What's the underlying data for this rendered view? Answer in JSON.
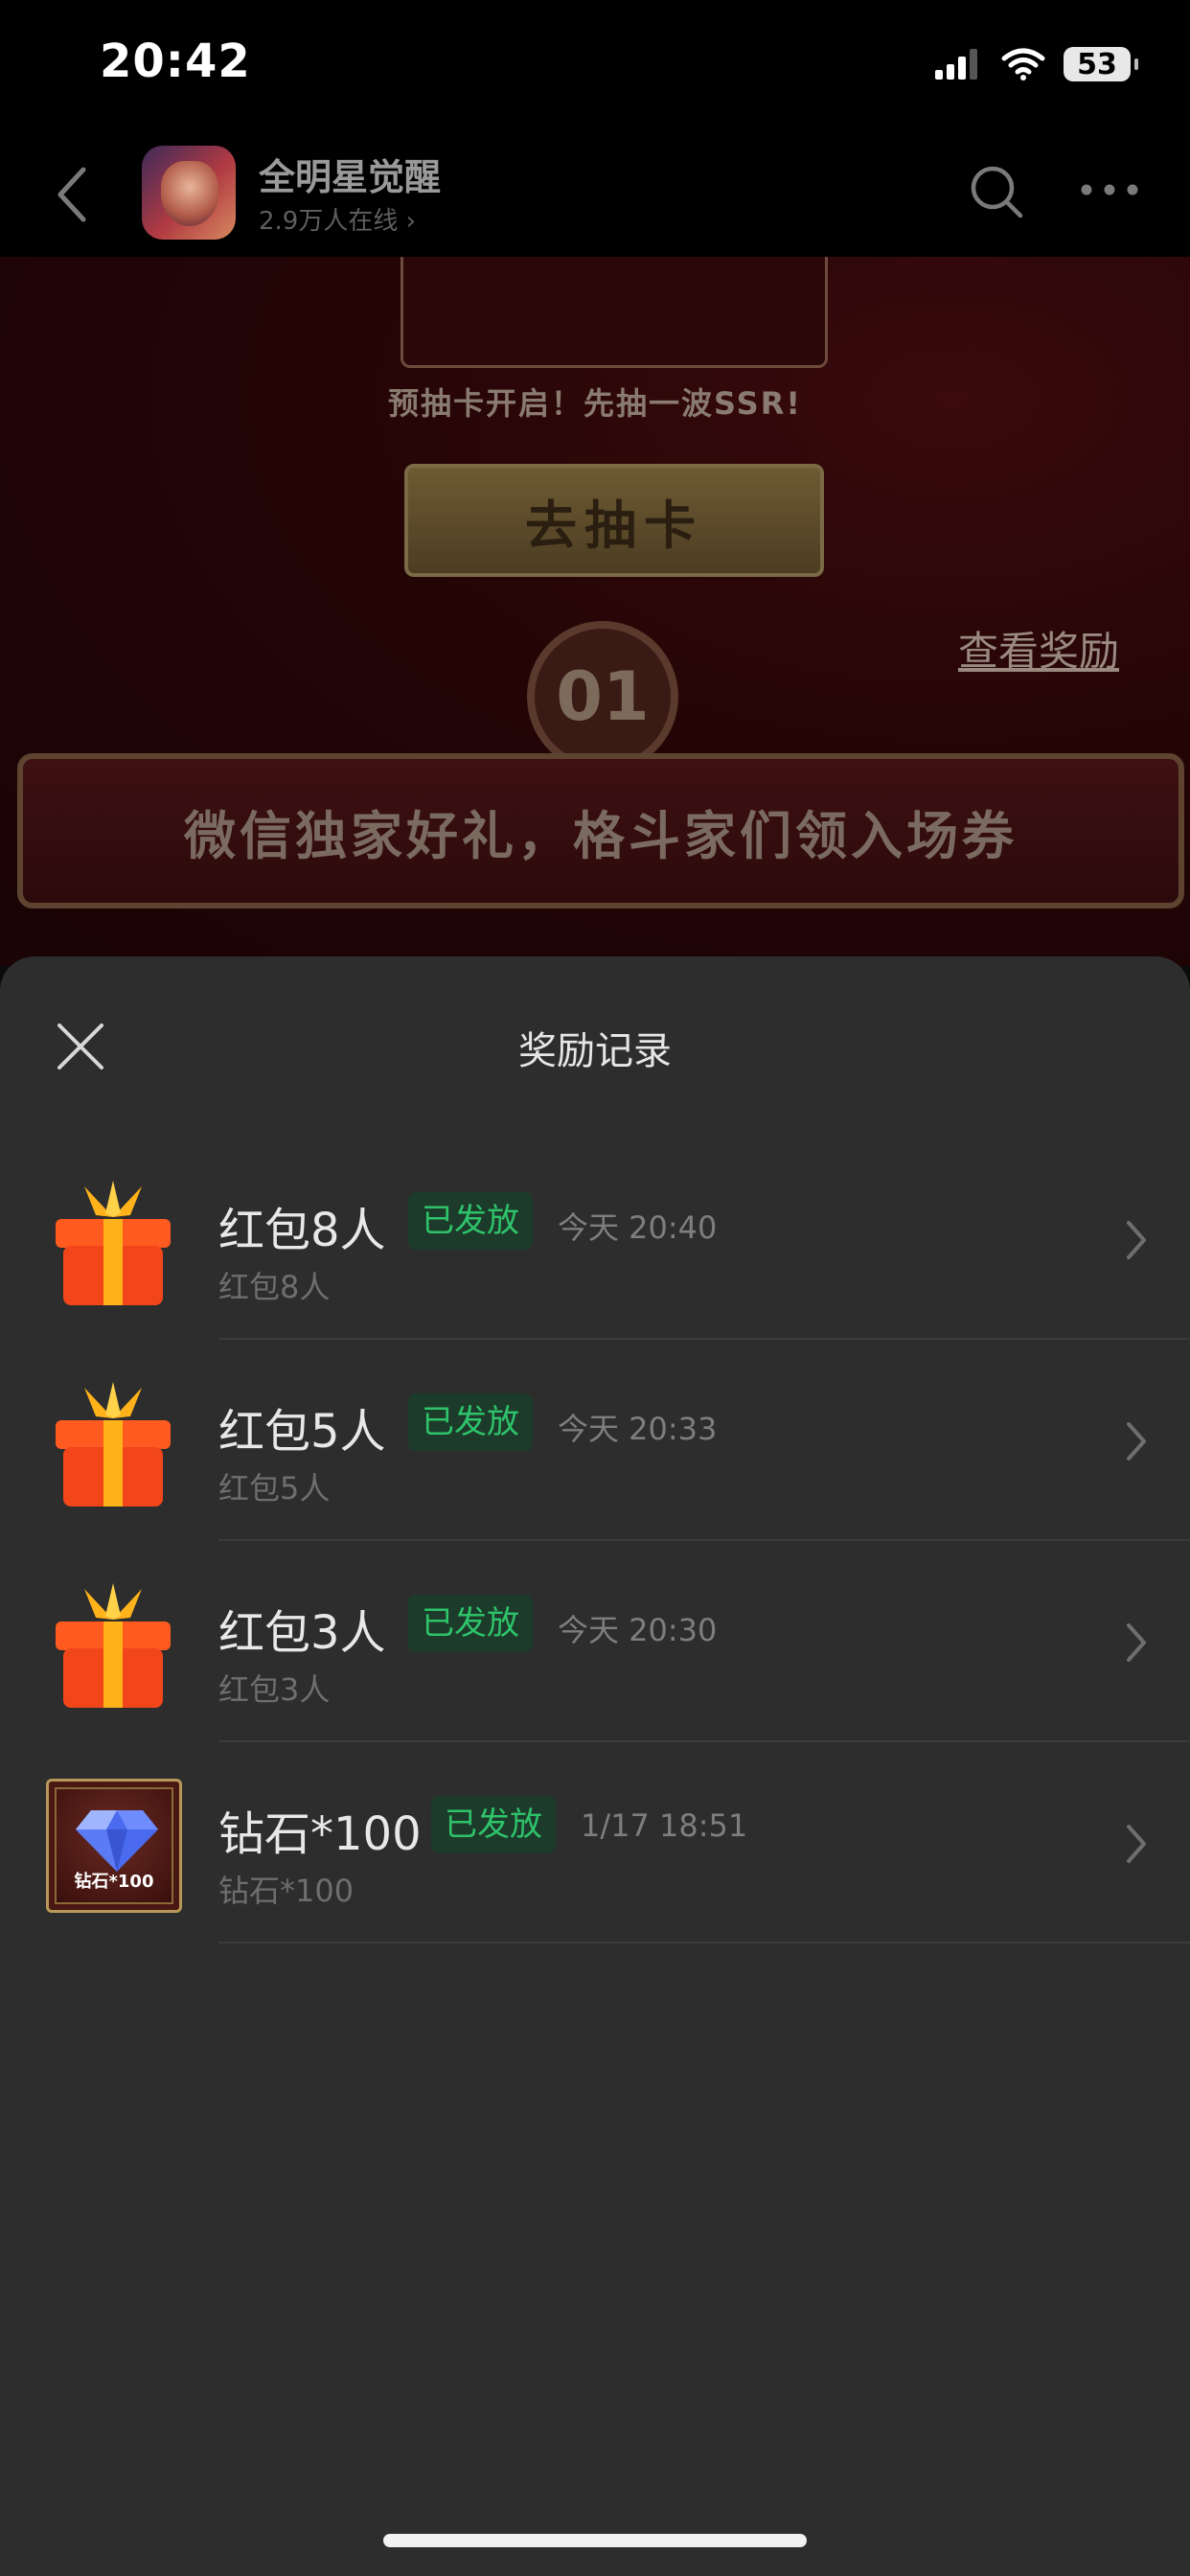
{
  "status_bar": {
    "time": "20:42",
    "battery": "53"
  },
  "nav": {
    "app_name": "全明星觉醒",
    "online_text": "2.9万人在线"
  },
  "background": {
    "promo_text": "预抽卡开启！先抽一波SSR!",
    "draw_button": "去抽卡",
    "view_reward": "查看奖励",
    "number_badge": "01",
    "banner_text": "微信独家好礼，格斗家们领入场券"
  },
  "sheet": {
    "title": "奖励记录",
    "records": [
      {
        "icon": "gift-icon",
        "name": "红包8人",
        "status": "已发放",
        "time": "今天 20:40",
        "sub": "红包8人"
      },
      {
        "icon": "gift-icon",
        "name": "红包5人",
        "status": "已发放",
        "time": "今天 20:33",
        "sub": "红包5人"
      },
      {
        "icon": "gift-icon",
        "name": "红包3人",
        "status": "已发放",
        "time": "今天 20:30",
        "sub": "红包3人"
      },
      {
        "icon": "diamond-icon",
        "name": "钻石*100",
        "status": "已发放",
        "time": "1/17 18:51",
        "sub": "钻石*100",
        "icon_label": "钻石*100"
      }
    ]
  },
  "colors": {
    "sheet_bg": "#2d2d2d",
    "status_green": "#2ec36b",
    "status_green_bg": "#1d3b2a"
  }
}
